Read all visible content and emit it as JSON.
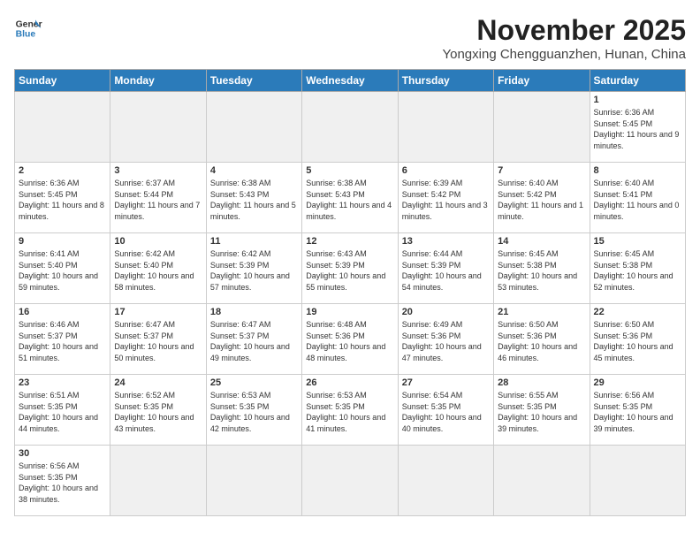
{
  "header": {
    "logo_general": "General",
    "logo_blue": "Blue",
    "month": "November 2025",
    "location": "Yongxing Chengguanzhen, Hunan, China"
  },
  "days_of_week": [
    "Sunday",
    "Monday",
    "Tuesday",
    "Wednesday",
    "Thursday",
    "Friday",
    "Saturday"
  ],
  "weeks": [
    [
      {
        "day": "",
        "empty": true
      },
      {
        "day": "",
        "empty": true
      },
      {
        "day": "",
        "empty": true
      },
      {
        "day": "",
        "empty": true
      },
      {
        "day": "",
        "empty": true
      },
      {
        "day": "",
        "empty": true
      },
      {
        "day": "1",
        "sunrise": "Sunrise: 6:36 AM",
        "sunset": "Sunset: 5:45 PM",
        "daylight": "Daylight: 11 hours and 9 minutes."
      }
    ],
    [
      {
        "day": "2",
        "sunrise": "Sunrise: 6:36 AM",
        "sunset": "Sunset: 5:45 PM",
        "daylight": "Daylight: 11 hours and 8 minutes."
      },
      {
        "day": "3",
        "sunrise": "Sunrise: 6:37 AM",
        "sunset": "Sunset: 5:44 PM",
        "daylight": "Daylight: 11 hours and 7 minutes."
      },
      {
        "day": "4",
        "sunrise": "Sunrise: 6:38 AM",
        "sunset": "Sunset: 5:43 PM",
        "daylight": "Daylight: 11 hours and 5 minutes."
      },
      {
        "day": "5",
        "sunrise": "Sunrise: 6:38 AM",
        "sunset": "Sunset: 5:43 PM",
        "daylight": "Daylight: 11 hours and 4 minutes."
      },
      {
        "day": "6",
        "sunrise": "Sunrise: 6:39 AM",
        "sunset": "Sunset: 5:42 PM",
        "daylight": "Daylight: 11 hours and 3 minutes."
      },
      {
        "day": "7",
        "sunrise": "Sunrise: 6:40 AM",
        "sunset": "Sunset: 5:42 PM",
        "daylight": "Daylight: 11 hours and 1 minute."
      },
      {
        "day": "8",
        "sunrise": "Sunrise: 6:40 AM",
        "sunset": "Sunset: 5:41 PM",
        "daylight": "Daylight: 11 hours and 0 minutes."
      }
    ],
    [
      {
        "day": "9",
        "sunrise": "Sunrise: 6:41 AM",
        "sunset": "Sunset: 5:40 PM",
        "daylight": "Daylight: 10 hours and 59 minutes."
      },
      {
        "day": "10",
        "sunrise": "Sunrise: 6:42 AM",
        "sunset": "Sunset: 5:40 PM",
        "daylight": "Daylight: 10 hours and 58 minutes."
      },
      {
        "day": "11",
        "sunrise": "Sunrise: 6:42 AM",
        "sunset": "Sunset: 5:39 PM",
        "daylight": "Daylight: 10 hours and 57 minutes."
      },
      {
        "day": "12",
        "sunrise": "Sunrise: 6:43 AM",
        "sunset": "Sunset: 5:39 PM",
        "daylight": "Daylight: 10 hours and 55 minutes."
      },
      {
        "day": "13",
        "sunrise": "Sunrise: 6:44 AM",
        "sunset": "Sunset: 5:39 PM",
        "daylight": "Daylight: 10 hours and 54 minutes."
      },
      {
        "day": "14",
        "sunrise": "Sunrise: 6:45 AM",
        "sunset": "Sunset: 5:38 PM",
        "daylight": "Daylight: 10 hours and 53 minutes."
      },
      {
        "day": "15",
        "sunrise": "Sunrise: 6:45 AM",
        "sunset": "Sunset: 5:38 PM",
        "daylight": "Daylight: 10 hours and 52 minutes."
      }
    ],
    [
      {
        "day": "16",
        "sunrise": "Sunrise: 6:46 AM",
        "sunset": "Sunset: 5:37 PM",
        "daylight": "Daylight: 10 hours and 51 minutes."
      },
      {
        "day": "17",
        "sunrise": "Sunrise: 6:47 AM",
        "sunset": "Sunset: 5:37 PM",
        "daylight": "Daylight: 10 hours and 50 minutes."
      },
      {
        "day": "18",
        "sunrise": "Sunrise: 6:47 AM",
        "sunset": "Sunset: 5:37 PM",
        "daylight": "Daylight: 10 hours and 49 minutes."
      },
      {
        "day": "19",
        "sunrise": "Sunrise: 6:48 AM",
        "sunset": "Sunset: 5:36 PM",
        "daylight": "Daylight: 10 hours and 48 minutes."
      },
      {
        "day": "20",
        "sunrise": "Sunrise: 6:49 AM",
        "sunset": "Sunset: 5:36 PM",
        "daylight": "Daylight: 10 hours and 47 minutes."
      },
      {
        "day": "21",
        "sunrise": "Sunrise: 6:50 AM",
        "sunset": "Sunset: 5:36 PM",
        "daylight": "Daylight: 10 hours and 46 minutes."
      },
      {
        "day": "22",
        "sunrise": "Sunrise: 6:50 AM",
        "sunset": "Sunset: 5:36 PM",
        "daylight": "Daylight: 10 hours and 45 minutes."
      }
    ],
    [
      {
        "day": "23",
        "sunrise": "Sunrise: 6:51 AM",
        "sunset": "Sunset: 5:35 PM",
        "daylight": "Daylight: 10 hours and 44 minutes."
      },
      {
        "day": "24",
        "sunrise": "Sunrise: 6:52 AM",
        "sunset": "Sunset: 5:35 PM",
        "daylight": "Daylight: 10 hours and 43 minutes."
      },
      {
        "day": "25",
        "sunrise": "Sunrise: 6:53 AM",
        "sunset": "Sunset: 5:35 PM",
        "daylight": "Daylight: 10 hours and 42 minutes."
      },
      {
        "day": "26",
        "sunrise": "Sunrise: 6:53 AM",
        "sunset": "Sunset: 5:35 PM",
        "daylight": "Daylight: 10 hours and 41 minutes."
      },
      {
        "day": "27",
        "sunrise": "Sunrise: 6:54 AM",
        "sunset": "Sunset: 5:35 PM",
        "daylight": "Daylight: 10 hours and 40 minutes."
      },
      {
        "day": "28",
        "sunrise": "Sunrise: 6:55 AM",
        "sunset": "Sunset: 5:35 PM",
        "daylight": "Daylight: 10 hours and 39 minutes."
      },
      {
        "day": "29",
        "sunrise": "Sunrise: 6:56 AM",
        "sunset": "Sunset: 5:35 PM",
        "daylight": "Daylight: 10 hours and 39 minutes."
      }
    ],
    [
      {
        "day": "30",
        "sunrise": "Sunrise: 6:56 AM",
        "sunset": "Sunset: 5:35 PM",
        "daylight": "Daylight: 10 hours and 38 minutes."
      },
      {
        "day": "",
        "empty": true
      },
      {
        "day": "",
        "empty": true
      },
      {
        "day": "",
        "empty": true
      },
      {
        "day": "",
        "empty": true
      },
      {
        "day": "",
        "empty": true
      },
      {
        "day": "",
        "empty": true
      }
    ]
  ]
}
